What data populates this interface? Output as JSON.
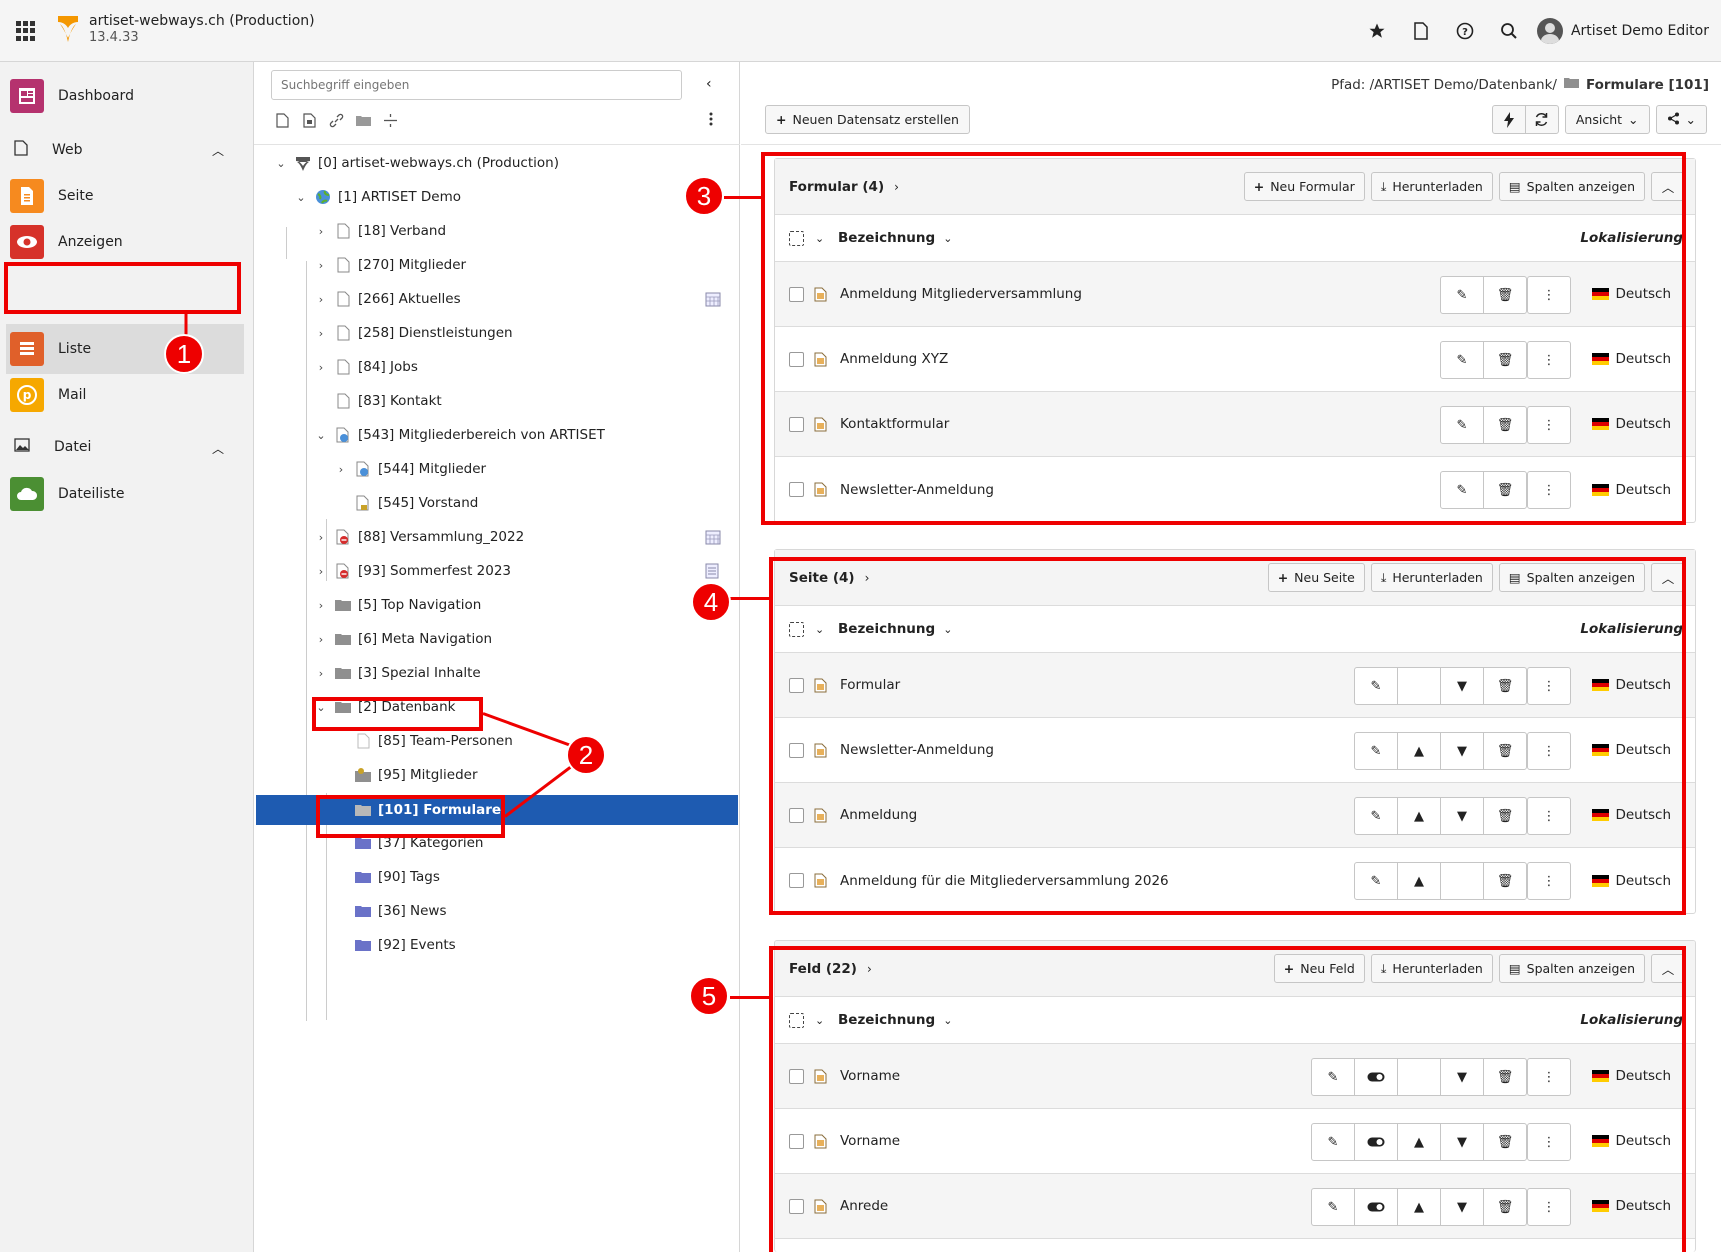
{
  "topbar": {
    "site_name": "artiset-webways.ch (Production)",
    "version": "13.4.33",
    "user_name": "Artiset Demo Editor"
  },
  "modules": {
    "dashboard": "Dashboard",
    "web_group": "Web",
    "seite": "Seite",
    "anzeigen": "Anzeigen",
    "liste": "Liste",
    "mail": "Mail",
    "datei_group": "Datei",
    "dateiliste": "Dateiliste"
  },
  "tree": {
    "search_placeholder": "Suchbegriff eingeben",
    "nodes": [
      "[0] artiset-webways.ch (Production)",
      "[1] ARTISET Demo",
      "[18] Verband",
      "[270] Mitglieder",
      "[266] Aktuelles",
      "[258] Dienstleistungen",
      "[84] Jobs",
      "[83] Kontakt",
      "[543] Mitgliederbereich von ARTISET",
      "[544] Mitglieder",
      "[545] Vorstand",
      "[88] Versammlung_2022",
      "[93] Sommerfest 2023",
      "[5] Top Navigation",
      "[6] Meta Navigation",
      "[3] Spezial Inhalte",
      "[2] Datenbank",
      "[85] Team-Personen",
      "[95] Mitglieder",
      "[101] Formulare",
      "[37] Kategorien",
      "[90] Tags",
      "[36] News",
      "[92] Events"
    ]
  },
  "main": {
    "path_label": "Pfad: /ARTISET Demo/Datenbank/",
    "path_current": "Formulare [101]",
    "new_record": "Neuen Datensatz erstellen",
    "ansicht": "Ansicht"
  },
  "panels": [
    {
      "title": "Formular (4)",
      "new_label": "Neu Formular",
      "download": "Herunterladen",
      "columns": "Spalten anzeigen",
      "col_label": "Bezeichnung",
      "col_loc": "Lokalisierung",
      "rows": [
        "Anmeldung Mitgliederversammlung",
        "Anmeldung XYZ",
        "Kontaktformular",
        "Newsletter-Anmeldung"
      ],
      "lang": "Deutsch"
    },
    {
      "title": "Seite (4)",
      "new_label": "Neu Seite",
      "download": "Herunterladen",
      "columns": "Spalten anzeigen",
      "col_label": "Bezeichnung",
      "col_loc": "Lokalisierung",
      "rows": [
        "Formular",
        "Newsletter-Anmeldung",
        "Anmeldung",
        "Anmeldung für die Mitgliederversammlung 2026"
      ],
      "lang": "Deutsch"
    },
    {
      "title": "Feld (22)",
      "new_label": "Neu Feld",
      "download": "Herunterladen",
      "columns": "Spalten anzeigen",
      "col_label": "Bezeichnung",
      "col_loc": "Lokalisierung",
      "rows": [
        "Vorname",
        "Vorname",
        "Anrede"
      ],
      "lang": "Deutsch"
    }
  ],
  "annotations": [
    "1",
    "2",
    "3",
    "4",
    "5"
  ],
  "colors": {
    "accent_selected": "#1e5bb1",
    "annotation_red": "#e00000"
  }
}
